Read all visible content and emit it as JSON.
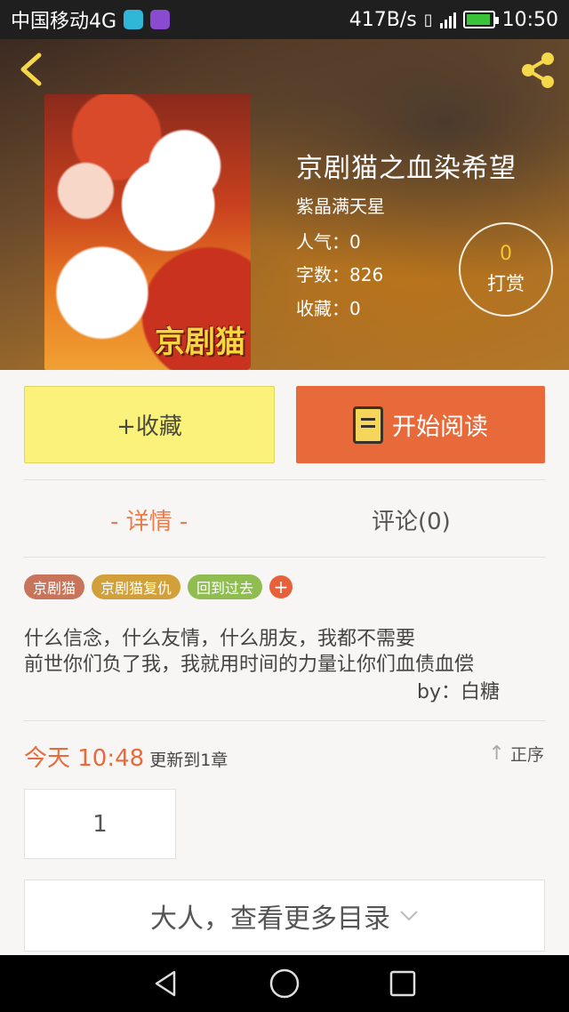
{
  "status_bar": {
    "carrier": "中国移动4G",
    "speed": "417B/s",
    "time": "10:50"
  },
  "book": {
    "title": "京剧猫之血染希望",
    "author": "紫晶满天星",
    "popularity": "人气：0",
    "word_count": "字数：826",
    "favorites": "收藏：0",
    "cover_title": "京剧猫"
  },
  "reward": {
    "count": "0",
    "label": "打赏"
  },
  "actions": {
    "collect_label": "+收藏",
    "read_label": "开始阅读"
  },
  "tabs": {
    "detail": "- 详情 -",
    "comments": "评论(0)"
  },
  "tags": [
    {
      "label": "京剧猫",
      "color": "#c8745a"
    },
    {
      "label": "京剧猫复仇",
      "color": "#d2a03a"
    },
    {
      "label": "回到过去",
      "color": "#8fbd50"
    }
  ],
  "tag_add": "+",
  "description": {
    "line1": "什么信念，什么友情，什么朋友，我都不需要",
    "line2": "前世你们负了我，我就用时间的力量让你们血债血偿",
    "byline": "by：白糖"
  },
  "update": {
    "time": "今天 10:48",
    "text": "更新到1章",
    "sort_label": "正序"
  },
  "chapters": [
    "1"
  ],
  "more_catalog": "大人，查看更多目录",
  "colors": {
    "accent": "#e86a3a",
    "collect_bg": "#faf27a"
  }
}
